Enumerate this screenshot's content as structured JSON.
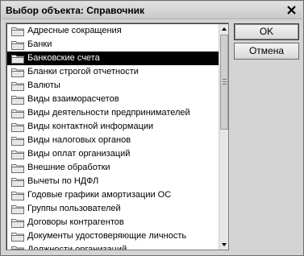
{
  "window": {
    "title": "Выбор объекта: Справочник",
    "close_icon": "close-icon"
  },
  "list": {
    "selected_index": 2,
    "items": [
      {
        "label": "Адресные сокращения",
        "icon": "folder-icon"
      },
      {
        "label": "Банки",
        "icon": "folder-icon"
      },
      {
        "label": "Банковские счета",
        "icon": "folder-icon"
      },
      {
        "label": "Бланки строгой отчетности",
        "icon": "folder-icon"
      },
      {
        "label": "Валюты",
        "icon": "folder-icon"
      },
      {
        "label": "Виды взаиморасчетов",
        "icon": "folder-icon"
      },
      {
        "label": "Виды деятельности предпринимателей",
        "icon": "folder-icon"
      },
      {
        "label": "Виды контактной информации",
        "icon": "folder-icon"
      },
      {
        "label": "Виды налоговых органов",
        "icon": "folder-icon"
      },
      {
        "label": "Виды оплат организаций",
        "icon": "folder-icon"
      },
      {
        "label": "Внешние обработки",
        "icon": "folder-icon"
      },
      {
        "label": "Вычеты по НДФЛ",
        "icon": "folder-icon"
      },
      {
        "label": "Годовые графики амортизации ОС",
        "icon": "folder-icon"
      },
      {
        "label": "Группы пользователей",
        "icon": "folder-icon"
      },
      {
        "label": "Договоры контрагентов",
        "icon": "folder-icon"
      },
      {
        "label": "Документы удостоверяющие личность",
        "icon": "folder-icon"
      },
      {
        "label": "Должности организаций",
        "icon": "folder-icon"
      }
    ]
  },
  "buttons": {
    "ok_label": "OK",
    "cancel_label": "Отмена"
  },
  "colors": {
    "selection_background": "#000000",
    "selection_text": "#ffffff",
    "dialog_background": "#d4d4d4"
  }
}
